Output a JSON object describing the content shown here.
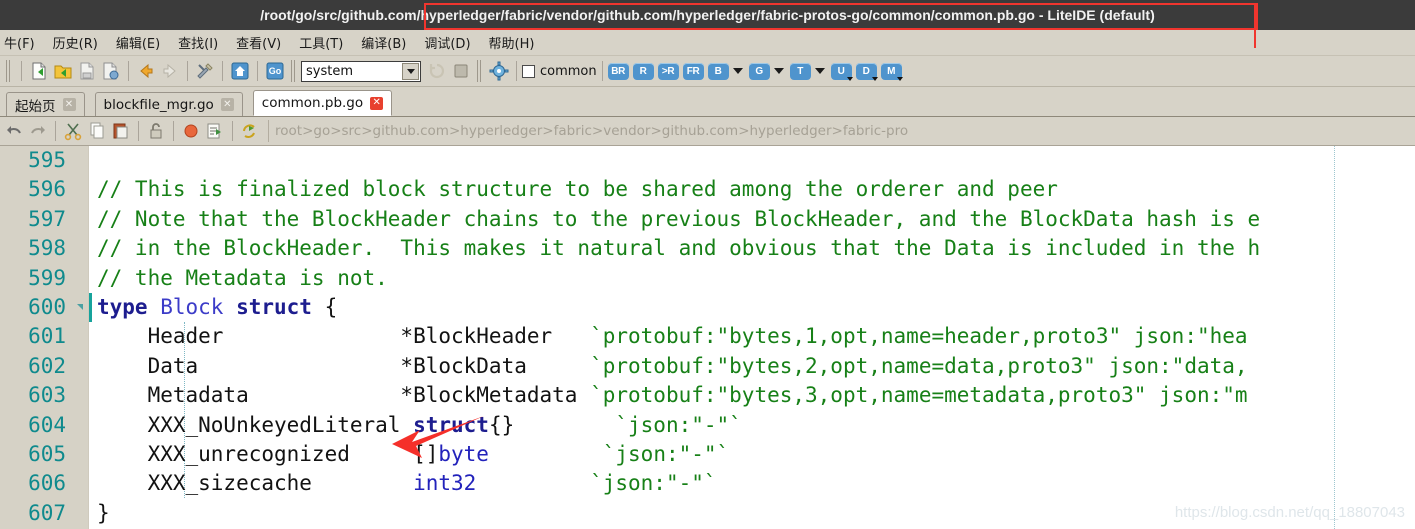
{
  "window": {
    "title_path": "/root/go/src/github.com/hyperledger/fabric/vendor/github.com/hyperledger/fabric-protos-go/common/common.pb.go",
    "title_suffix": " - LiteIDE (default)",
    "highlight_color": "#f0352e"
  },
  "menubar": {
    "items": [
      {
        "label": "牛(F)"
      },
      {
        "label": "历史(R)"
      },
      {
        "label": "编辑(E)"
      },
      {
        "label": "查找(I)"
      },
      {
        "label": "查看(V)"
      },
      {
        "label": "工具(T)"
      },
      {
        "label": "编译(B)"
      },
      {
        "label": "调试(D)"
      },
      {
        "label": "帮助(H)"
      }
    ]
  },
  "toolbar": {
    "env_combo_value": "system",
    "checkbox_label": "common",
    "checkbox_checked": false,
    "debug_buttons": [
      {
        "label": "BR",
        "caret": false
      },
      {
        "label": "R",
        "caret": false
      },
      {
        "label": ">R",
        "caret": false
      },
      {
        "label": "FR",
        "caret": false
      },
      {
        "label": "B",
        "caret": true
      },
      {
        "label": "G",
        "caret": true
      },
      {
        "label": "T",
        "caret": true
      },
      {
        "label": "U",
        "caret": false,
        "mini": true
      },
      {
        "label": "D",
        "caret": false,
        "mini": true
      },
      {
        "label": "M",
        "caret": false,
        "mini": true
      }
    ],
    "icons": [
      "new-file-icon",
      "open-folder-icon",
      "save-file-icon",
      "save-all-icon",
      "back-arrow-icon",
      "forward-arrow-icon",
      "build-tools-icon",
      "home-icon",
      "go-icon",
      "reload-icon",
      "stop-icon",
      "settings-gear-icon"
    ]
  },
  "tabs": [
    {
      "label": "起始页",
      "active": false
    },
    {
      "label": "blockfile_mgr.go",
      "active": false
    },
    {
      "label": "common.pb.go",
      "active": true
    }
  ],
  "edit_toolbar": {
    "icons": [
      "undo-icon",
      "redo-icon",
      "cut-icon",
      "copy-icon",
      "paste-icon",
      "lock-icon",
      "bookmark-icon",
      "goto-definition-icon",
      "jump-icon"
    ],
    "breadcrumb": "root>go>src>github.com>hyperledger>fabric>vendor>github.com>hyperledger>fabric-pro"
  },
  "editor": {
    "lines": [
      {
        "number": "595",
        "fold": false,
        "current": false,
        "tokens": []
      },
      {
        "number": "596",
        "fold": false,
        "current": false,
        "tokens": [
          {
            "t": "// This is finalized block structure to be shared among the orderer and peer",
            "c": "cmt"
          }
        ]
      },
      {
        "number": "597",
        "fold": false,
        "current": false,
        "tokens": [
          {
            "t": "// Note that the BlockHeader chains to the previous BlockHeader, and the BlockData hash is e",
            "c": "cmt"
          }
        ]
      },
      {
        "number": "598",
        "fold": false,
        "current": false,
        "tokens": [
          {
            "t": "// in the BlockHeader.  This makes it natural and obvious that the Data is included in the h",
            "c": "cmt"
          }
        ]
      },
      {
        "number": "599",
        "fold": false,
        "current": false,
        "tokens": [
          {
            "t": "// the Metadata is not.",
            "c": "cmt"
          }
        ]
      },
      {
        "number": "600",
        "fold": true,
        "current": true,
        "tokens": [
          {
            "t": "type ",
            "c": "kw"
          },
          {
            "t": "Block ",
            "c": "typ"
          },
          {
            "t": "struct ",
            "c": "kw"
          },
          {
            "t": "{",
            "c": "pln"
          }
        ]
      },
      {
        "number": "601",
        "fold": false,
        "current": false,
        "tokens": [
          {
            "t": "    Header              *BlockHeader   ",
            "c": "pln"
          },
          {
            "t": "`protobuf:\"bytes,1,opt,name=header,proto3\" json:\"hea",
            "c": "tag"
          }
        ]
      },
      {
        "number": "602",
        "fold": false,
        "current": false,
        "tokens": [
          {
            "t": "    Data                *BlockData     ",
            "c": "pln"
          },
          {
            "t": "`protobuf:\"bytes,2,opt,name=data,proto3\" json:\"data,",
            "c": "tag"
          }
        ]
      },
      {
        "number": "603",
        "fold": false,
        "current": false,
        "tokens": [
          {
            "t": "    Metadata            *BlockMetadata ",
            "c": "pln"
          },
          {
            "t": "`protobuf:\"bytes,3,opt,name=metadata,proto3\" json:\"m",
            "c": "tag"
          }
        ]
      },
      {
        "number": "604",
        "fold": false,
        "current": false,
        "tokens": [
          {
            "t": "    XXX_NoUnkeyedLiteral ",
            "c": "pln"
          },
          {
            "t": "struct",
            "c": "kw"
          },
          {
            "t": "{}        ",
            "c": "pln"
          },
          {
            "t": "`json:\"-\"`",
            "c": "tag"
          }
        ]
      },
      {
        "number": "605",
        "fold": false,
        "current": false,
        "tokens": [
          {
            "t": "    XXX_unrecognized     []",
            "c": "pln"
          },
          {
            "t": "byte",
            "c": "bi"
          },
          {
            "t": "         ",
            "c": "pln"
          },
          {
            "t": "`json:\"-\"`",
            "c": "tag"
          }
        ]
      },
      {
        "number": "606",
        "fold": false,
        "current": false,
        "tokens": [
          {
            "t": "    XXX_sizecache        ",
            "c": "pln"
          },
          {
            "t": "int32",
            "c": "bi"
          },
          {
            "t": "         ",
            "c": "pln"
          },
          {
            "t": "`json:\"-\"`",
            "c": "tag"
          }
        ]
      },
      {
        "number": "607",
        "fold": false,
        "current": false,
        "tokens": [
          {
            "t": "}",
            "c": "pln"
          }
        ]
      }
    ],
    "colors": {
      "comment": "#178017",
      "keyword": "#1d1d8f",
      "type": "#3c3cc8",
      "builtin": "#2222bb",
      "tag_string": "#178017",
      "line_number": "#0f8a8d",
      "gutter_bg": "#d6d2c6",
      "background": "#ffffff"
    }
  },
  "annotation": {
    "arrow_color": "#f5302a",
    "name": "red-pointer-arrow"
  },
  "watermark": {
    "text": "https://blog.csdn.net/qq_18807043"
  }
}
